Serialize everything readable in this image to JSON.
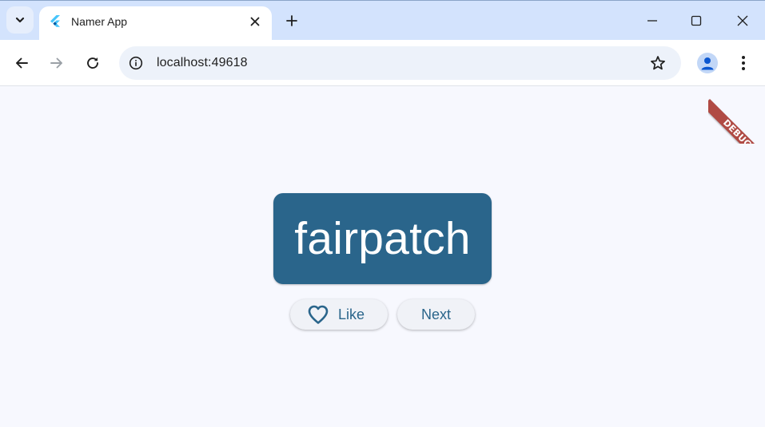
{
  "browser": {
    "tab": {
      "title": "Namer App",
      "favicon": "flutter-icon"
    },
    "address_bar": {
      "url": "localhost:49618"
    },
    "icons": {
      "tab_search": "chevron-down-icon",
      "tab_close": "close-icon",
      "new_tab": "plus-icon",
      "minimize": "minimize-icon",
      "maximize": "maximize-icon",
      "window_close": "close-icon",
      "back": "arrow-left-icon",
      "forward": "arrow-right-icon",
      "reload": "reload-icon",
      "site_info": "info-icon",
      "bookmark": "star-icon",
      "profile": "person-icon",
      "menu": "more-vert-icon"
    }
  },
  "app": {
    "word": "fairpatch",
    "buttons": {
      "like_label": "Like",
      "like_icon": "heart-outline-icon",
      "next_label": "Next"
    },
    "debug_banner": "DEBUG"
  },
  "colors": {
    "card": "#2a658b",
    "accent": "#2a658b",
    "background": "#f7f8fe",
    "tabstrip": "#d3e3fd",
    "debug_ribbon": "#b04a44"
  }
}
